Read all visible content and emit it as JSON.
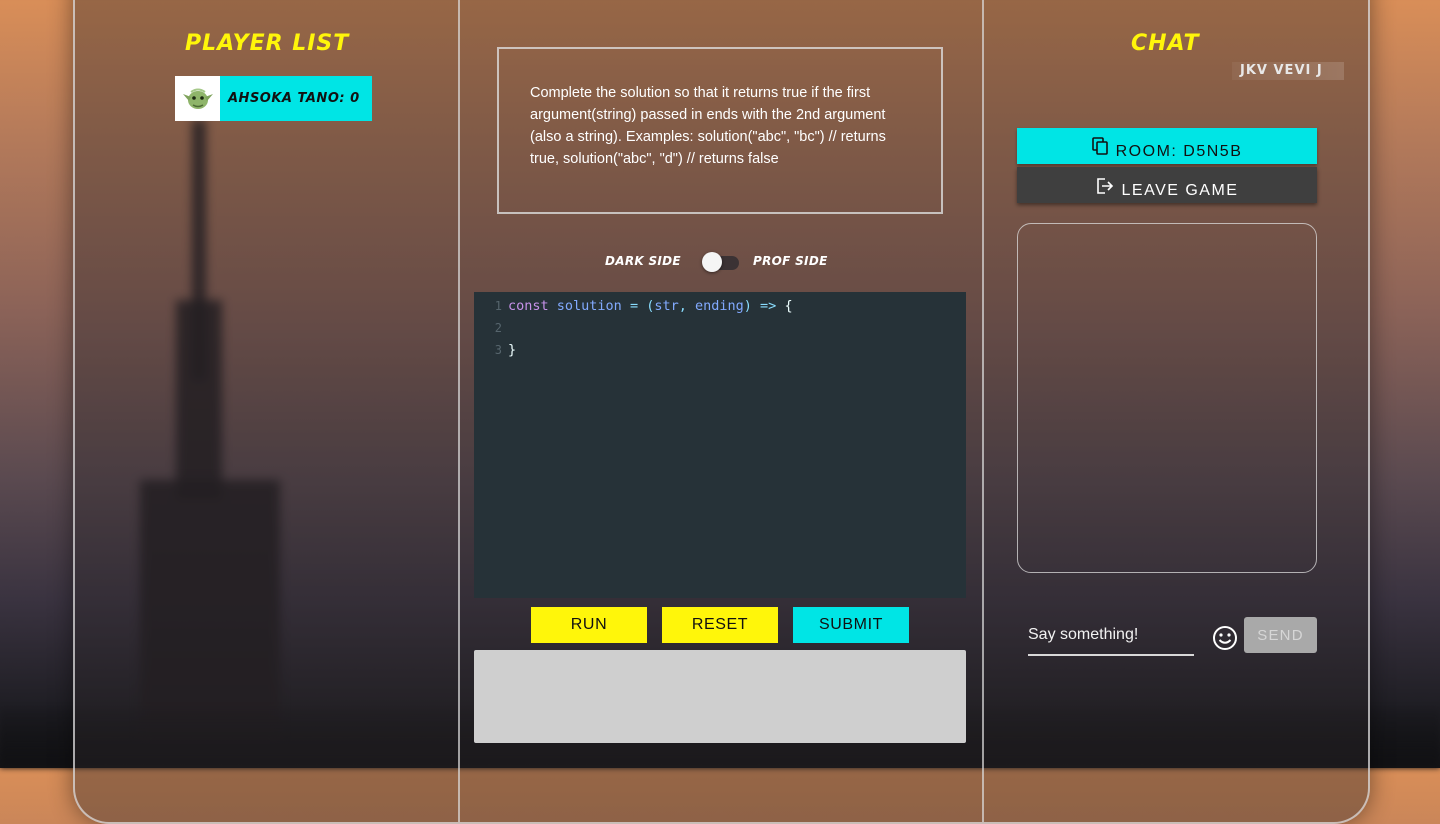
{
  "colors": {
    "accent_cyan": "#00e5e5",
    "accent_yellow": "#fff60a",
    "editor_bg": "#263238",
    "output_bg": "#cfcfcf"
  },
  "player_list": {
    "title": "PLAYER LIST",
    "players": [
      {
        "name": "AHSOKA TANO",
        "score": "0",
        "label": "AHSOKA TANO: 0",
        "avatar_icon": "yoda-avatar-icon"
      }
    ]
  },
  "challenge": {
    "prompt": "Complete the solution so that it returns true if the first argument(string) passed in ends with the 2nd argument (also a string). Examples: solution(\"abc\", \"bc\") // returns true, solution(\"abc\", \"d\") // returns false"
  },
  "theme_toggle": {
    "left_label": "DARK SIDE",
    "right_label": "PROF SIDE",
    "state": "off"
  },
  "editor": {
    "line_numbers": [
      "1",
      "2",
      "3"
    ],
    "line1": {
      "kw": "const",
      "name": "solution",
      "eq": " = ",
      "open": "(",
      "p1": "str",
      "comma": ", ",
      "p2": "ending",
      "close": ")",
      "arrow": " => ",
      "brace": "{"
    },
    "line3": "}"
  },
  "actions": {
    "run": "RUN",
    "reset": "RESET",
    "submit": "SUBMIT"
  },
  "chat": {
    "title": "CHAT",
    "aurebesh_text": "JKV VEVI J",
    "room_label": "ROOM: D5N5B",
    "leave_label": "LEAVE GAME",
    "input_placeholder": "Say something!",
    "send_label": "SEND",
    "emoji_icon": "smiley-icon"
  }
}
